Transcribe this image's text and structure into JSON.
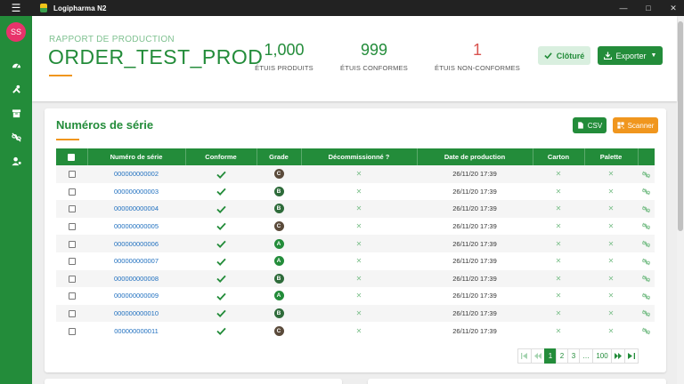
{
  "window": {
    "app_title": "Logipharma N2",
    "menu_icon": "hamburger-icon",
    "controls": [
      {
        "name": "minimize-icon",
        "glyph": "—"
      },
      {
        "name": "maximize-icon",
        "glyph": "□"
      },
      {
        "name": "close-icon",
        "glyph": "✕"
      }
    ]
  },
  "sidebar": {
    "avatar_initials": "SS",
    "items": [
      {
        "name": "dashboard-gauge-icon"
      },
      {
        "name": "tools-icon"
      },
      {
        "name": "archive-box-icon"
      },
      {
        "name": "unlink-icon"
      },
      {
        "name": "user-settings-icon"
      }
    ]
  },
  "header": {
    "section_label": "RAPPORT DE PRODUCTION",
    "order_name": "ORDER_TEST_PROD",
    "stats": [
      {
        "value": "1,000",
        "label": "ÉTUIS PRODUITS",
        "color": "#238c3a"
      },
      {
        "value": "999",
        "label": "ÉTUIS CONFORMES",
        "color": "#238c3a"
      },
      {
        "value": "1",
        "label": "ÉTUIS NON-CONFORMES",
        "color": "#d9534f"
      }
    ],
    "close_button": "Clôturé",
    "export_button": "Exporter"
  },
  "serials": {
    "title": "Numéros de série",
    "csv_button": "CSV",
    "scanner_button": "Scanner",
    "columns": [
      "Numéro de série",
      "Conforme",
      "Grade",
      "Décommissionné ?",
      "Date de production",
      "Carton",
      "Palette"
    ],
    "rows": [
      {
        "serial": "000000000002",
        "grade": "C",
        "date": "26/11/20 17:39"
      },
      {
        "serial": "000000000003",
        "grade": "B",
        "date": "26/11/20 17:39"
      },
      {
        "serial": "000000000004",
        "grade": "B",
        "date": "26/11/20 17:39"
      },
      {
        "serial": "000000000005",
        "grade": "C",
        "date": "26/11/20 17:39"
      },
      {
        "serial": "000000000006",
        "grade": "A",
        "date": "26/11/20 17:39"
      },
      {
        "serial": "000000000007",
        "grade": "A",
        "date": "26/11/20 17:39"
      },
      {
        "serial": "000000000008",
        "grade": "B",
        "date": "26/11/20 17:39"
      },
      {
        "serial": "000000000009",
        "grade": "A",
        "date": "26/11/20 17:39"
      },
      {
        "serial": "000000000010",
        "grade": "B",
        "date": "26/11/20 17:39"
      },
      {
        "serial": "000000000011",
        "grade": "C",
        "date": "26/11/20 17:39"
      }
    ],
    "grade_colors": {
      "A": "#238c3a",
      "B": "#2e6b3a",
      "C": "#5a4a3a"
    },
    "pagination": [
      "1",
      "2",
      "3",
      "…",
      "100"
    ]
  },
  "colors": {
    "primary": "#238c3a",
    "accent": "#f0961e",
    "danger": "#d9534f"
  }
}
